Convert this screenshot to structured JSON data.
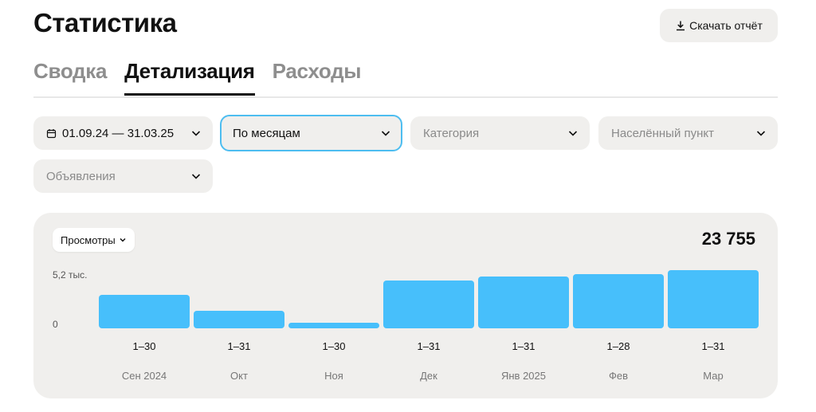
{
  "header": {
    "title": "Статистика",
    "download_label": "Скачать отчёт"
  },
  "tabs": [
    {
      "label": "Сводка",
      "active": false
    },
    {
      "label": "Детализация",
      "active": true
    },
    {
      "label": "Расходы",
      "active": false
    }
  ],
  "filters": {
    "date_range": "01.09.24 — 31.03.25",
    "grouping": "По месяцам",
    "category_placeholder": "Категория",
    "city_placeholder": "Населённый пункт",
    "ads_placeholder": "Объявления"
  },
  "chart": {
    "metric_label": "Просмотры",
    "total": "23 755",
    "y_tick_top": "5,2 тыс.",
    "y_tick_zero": "0"
  },
  "colors": {
    "bar": "#47bffb",
    "focus_border": "#4dbdf0",
    "card_bg": "#f0efed"
  },
  "chart_data": {
    "type": "bar",
    "categories": [
      "Сен 2024",
      "Окт",
      "Ноя",
      "Дек",
      "Янв 2025",
      "Фев",
      "Мар"
    ],
    "ranges": [
      "1–30",
      "1–31",
      "1–30",
      "1–31",
      "1–31",
      "1–28",
      "1–31"
    ],
    "values": [
      3600,
      1900,
      600,
      5200,
      5600,
      5900,
      6300
    ],
    "ylabel": "",
    "yticks": [
      "0",
      "5,2 тыс."
    ],
    "ylim": [
      0,
      5200
    ]
  }
}
